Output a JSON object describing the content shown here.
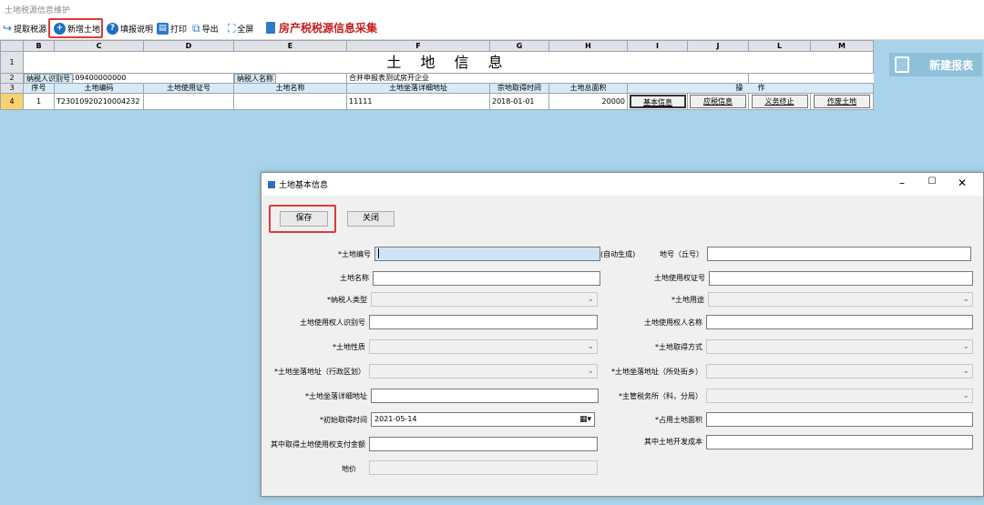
{
  "window": {
    "title": "土地税源信息维护"
  },
  "toolbar": {
    "items": [
      "提取税源",
      "新增土地",
      "填报说明",
      "打印",
      "导出",
      "全屏"
    ],
    "heading": "房产税税源信息采集"
  },
  "sheet": {
    "columns": [
      "B",
      "C",
      "D",
      "E",
      "F",
      "G",
      "H",
      "I",
      "J",
      "L",
      "M"
    ],
    "row_numbers": [
      "1",
      "2",
      "3",
      "4"
    ],
    "title": "土 地 信 息",
    "row2": {
      "taxpayer_id_label": "纳税人识别号",
      "taxpayer_id_value": "230109400000000",
      "taxpayer_name_label": "纳税人名称",
      "taxpayer_name_value": "合并申报表测试房开企业"
    },
    "headers": [
      "序号",
      "土地编码",
      "土地使用证号",
      "土地名称",
      "土地坐落详细地址",
      "宗地取得时间",
      "土地总面积",
      "操　　作"
    ],
    "row": {
      "seq": "1",
      "code": "T23010920210004232",
      "cert": "",
      "name": "",
      "address": "11111",
      "date": "2018-01-01",
      "area": "20000",
      "ops": [
        "基本信息",
        "应税信息",
        "义务终止",
        "作废土地"
      ]
    }
  },
  "new_report": {
    "label": "新建报表"
  },
  "dialog": {
    "title": "土地基本信息",
    "save_label": "保存",
    "close_label": "关闭",
    "fields": {
      "land_no_label": "*土地编号",
      "land_no_suffix": "(自动生成)",
      "lot_no_label": "地号（丘号）",
      "land_name_label": "土地名称",
      "cert_no_label": "土地使用权证号",
      "taxpayer_type_label": "*纳税人类型",
      "land_use_label": "*土地用途",
      "user_id_label": "土地使用权人识别号",
      "user_name_label": "土地使用权人名称",
      "land_nature_label": "*土地性质",
      "acquire_method_label": "*土地取得方式",
      "district_label": "*土地坐落地址（行政区划）",
      "street_label": "*土地坐落地址（所处街乡）",
      "detail_addr_label": "*土地坐落详细地址",
      "tax_office_label": "*主管税务所（科，分局）",
      "first_acq_label": "*初始取得时间",
      "first_acq_value": "2021-05-14",
      "occupied_area_label": "*占用土地面积",
      "payment_label": "其中取得土地使用权支付金额",
      "dev_cost_label": "其中土地开发成本",
      "price_label": "地价"
    }
  }
}
